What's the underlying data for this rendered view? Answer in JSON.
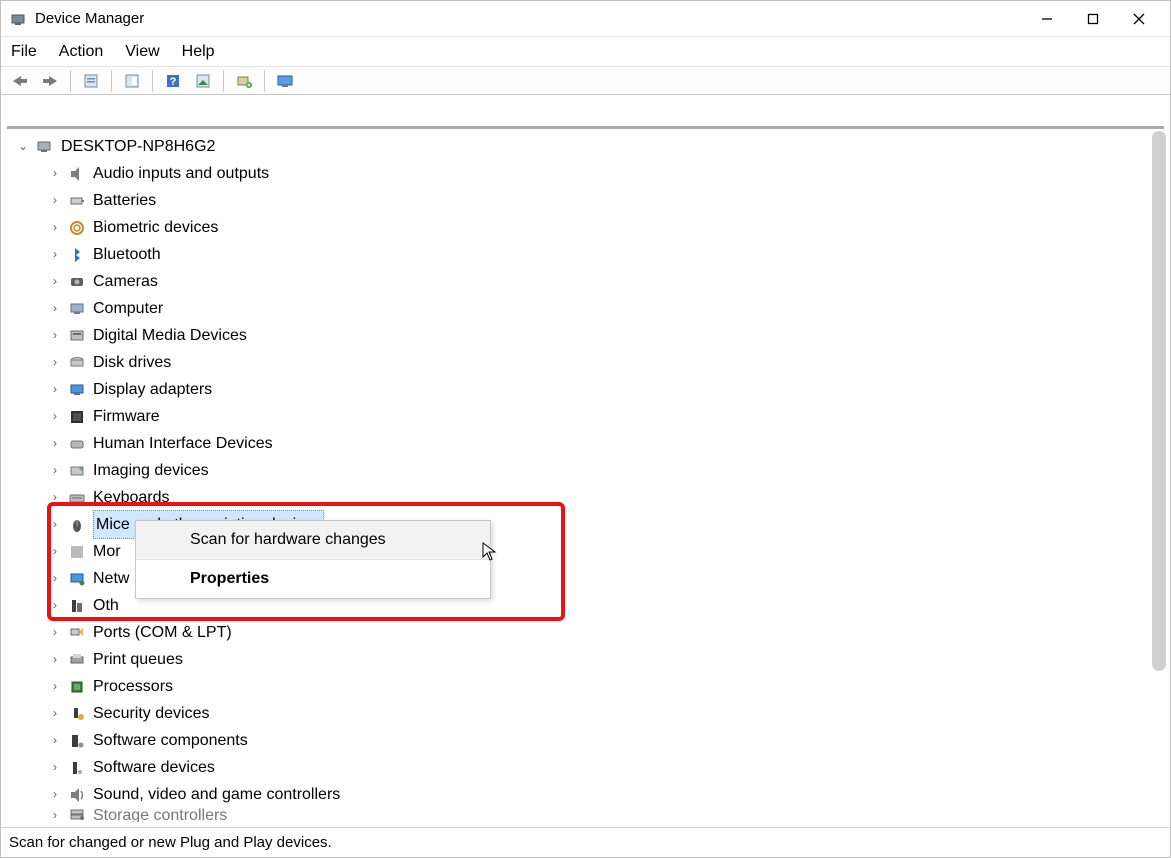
{
  "window": {
    "title": "Device Manager"
  },
  "menu": {
    "file": "File",
    "action": "Action",
    "view": "View",
    "help": "Help"
  },
  "tree": {
    "root": "DESKTOP-NP8H6G2",
    "categories": [
      "Audio inputs and outputs",
      "Batteries",
      "Biometric devices",
      "Bluetooth",
      "Cameras",
      "Computer",
      "Digital Media Devices",
      "Disk drives",
      "Display adapters",
      "Firmware",
      "Human Interface Devices",
      "Imaging devices",
      "Keyboards",
      "Mice and other pointing devices",
      "Mor",
      "Netw",
      "Oth",
      "Ports (COM & LPT)",
      "Print queues",
      "Processors",
      "Security devices",
      "Software components",
      "Software devices",
      "Sound, video and game controllers",
      "Storage controllers"
    ],
    "category_full": {
      "14": "Monitors",
      "15": "Network adapters",
      "16": "Other devices"
    },
    "selected_index": 13
  },
  "context_menu": {
    "scan": "Scan for hardware changes",
    "properties": "Properties"
  },
  "statusbar": {
    "text": "Scan for changed or new Plug and Play devices."
  }
}
